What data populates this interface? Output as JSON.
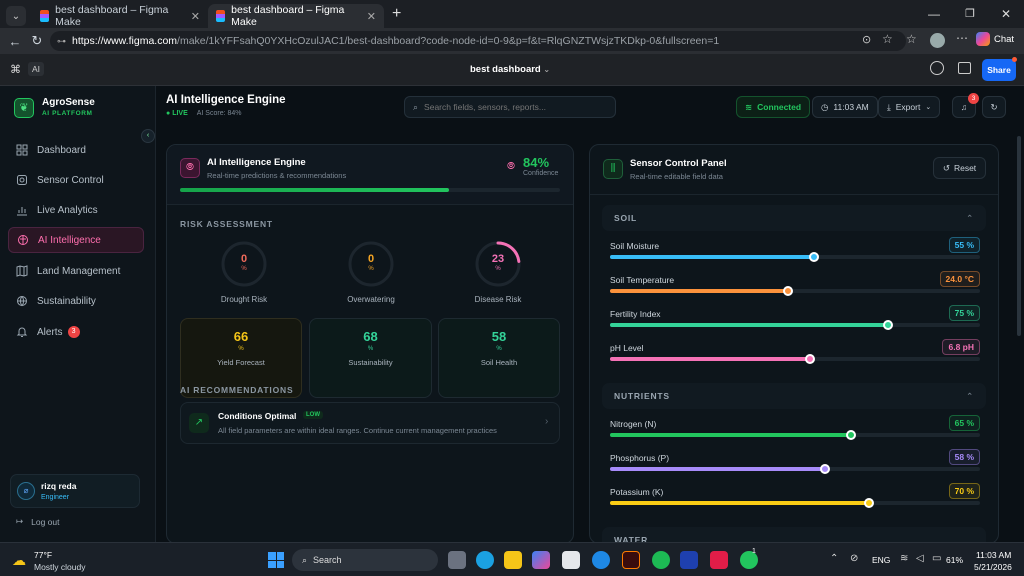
{
  "browser": {
    "tabs": [
      {
        "label": "best dashboard – Figma Make"
      },
      {
        "label": "best dashboard – Figma Make"
      }
    ],
    "url_host": "https://www.figma.com",
    "url_rest": "/make/1kYFFsahQ0YXHcOzulJAC1/best-dashboard?code-node-id=0-9&p=f&t=RlqGNZTWsjzTKDkp-0&fullscreen=1",
    "chat_label": "Chat"
  },
  "figma": {
    "ai_label": "AI",
    "file_title": "best dashboard",
    "share_label": "Share"
  },
  "brand": {
    "name": "AgroSense",
    "sub": "AI PLATFORM"
  },
  "sidebar": {
    "items": [
      {
        "label": "Dashboard"
      },
      {
        "label": "Sensor Control"
      },
      {
        "label": "Live Analytics"
      },
      {
        "label": "AI Intelligence"
      },
      {
        "label": "Land Management"
      },
      {
        "label": "Sustainability"
      },
      {
        "label": "Alerts",
        "badge": "3"
      }
    ],
    "user": {
      "name": "rizq reda",
      "role": "Engineer"
    },
    "logout": "Log out"
  },
  "header": {
    "title": "AI Intelligence Engine",
    "live": "LIVE",
    "score": "AI Score: 84%",
    "search_placeholder": "Search fields, sensors, reports...",
    "connected": "Connected",
    "time": "11:03 AM",
    "export": "Export",
    "notif_count": "3"
  },
  "ai_card": {
    "title": "AI Intelligence Engine",
    "subtitle": "Real-time predictions & recommendations",
    "confidence_value": "84%",
    "confidence_label": "Confidence",
    "progress": 0.84,
    "risk_label": "RISK ASSESSMENT",
    "risks": [
      {
        "value": "0",
        "unit": "%",
        "label": "Drought Risk",
        "level": 0
      },
      {
        "value": "0",
        "unit": "%",
        "label": "Overwatering",
        "level": 0
      },
      {
        "value": "23",
        "unit": "%",
        "label": "Disease Risk",
        "level": 0.23
      }
    ],
    "metrics": [
      {
        "value": "66",
        "unit": "%",
        "label": "Yield Forecast",
        "color": "#f5c518"
      },
      {
        "value": "68",
        "unit": "%",
        "label": "Sustainability",
        "color": "#34d399"
      },
      {
        "value": "58",
        "unit": "%",
        "label": "Soil Health",
        "color": "#34d399"
      }
    ],
    "rec_label": "AI RECOMMENDATIONS",
    "rec": {
      "title": "Conditions Optimal",
      "badge": "LOW",
      "text": "All field parameters are within ideal ranges. Continue current management practices"
    }
  },
  "sensor_card": {
    "title": "Sensor Control Panel",
    "subtitle": "Real-time editable field data",
    "reset": "Reset",
    "sections": [
      {
        "name": "SOIL",
        "rows": [
          {
            "label": "Soil Moisture",
            "value": "55 %",
            "level": 0.55,
            "color": "#38bdf8"
          },
          {
            "label": "Soil Temperature",
            "value": "24.0 °C",
            "level": 0.48,
            "color": "#fb923c"
          },
          {
            "label": "Fertility Index",
            "value": "75 %",
            "level": 0.75,
            "color": "#34d399"
          },
          {
            "label": "pH Level",
            "value": "6.8 pH",
            "level": 0.54,
            "color": "#f472b6"
          }
        ]
      },
      {
        "name": "NUTRIENTS",
        "rows": [
          {
            "label": "Nitrogen (N)",
            "value": "65 %",
            "level": 0.65,
            "color": "#22c55e"
          },
          {
            "label": "Phosphorus (P)",
            "value": "58 %",
            "level": 0.58,
            "color": "#a78bfa"
          },
          {
            "label": "Potassium (K)",
            "value": "70 %",
            "level": 0.7,
            "color": "#facc15"
          }
        ]
      },
      {
        "name": "WATER",
        "rows": []
      }
    ]
  },
  "taskbar": {
    "weather_temp": "77°F",
    "weather_text": "Mostly cloudy",
    "search": "Search",
    "lang": "ENG",
    "battery": "61%",
    "time": "11:03 AM",
    "date": "5/21/2026",
    "chrome_badge": "1"
  }
}
